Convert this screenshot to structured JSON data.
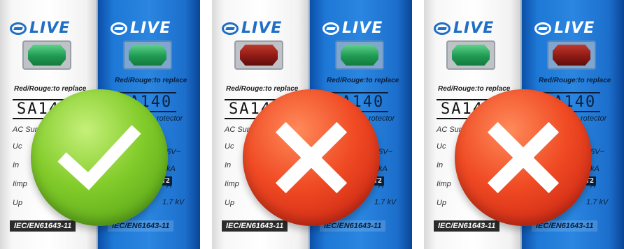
{
  "brand": "LIVE",
  "module": {
    "replace_note": "Red/Rouge:to replace",
    "model": "SA140",
    "type_text_fragment": "AC Sur",
    "type_text_fragment_blue": "rotector",
    "specs": [
      "Uc",
      "In",
      "Iimp",
      "Up"
    ],
    "spec_values": [
      "5V~",
      "kA",
      "A",
      "1.7 kV"
    ],
    "class_badge": "T2",
    "standard": "IEC/EN61643-11"
  },
  "panels": [
    {
      "white_indicator": "green",
      "blue_indicator": "green",
      "verdict": "ok",
      "verdict_icon": "check-icon"
    },
    {
      "white_indicator": "red",
      "blue_indicator": "green",
      "verdict": "bad",
      "verdict_icon": "cross-icon"
    },
    {
      "white_indicator": "green",
      "blue_indicator": "red",
      "verdict": "bad",
      "verdict_icon": "cross-icon"
    }
  ],
  "colors": {
    "ok": "#6cc11f",
    "bad": "#e8341c",
    "blue_module": "#1e78d6",
    "logo_blue": "#1f6fc6"
  }
}
